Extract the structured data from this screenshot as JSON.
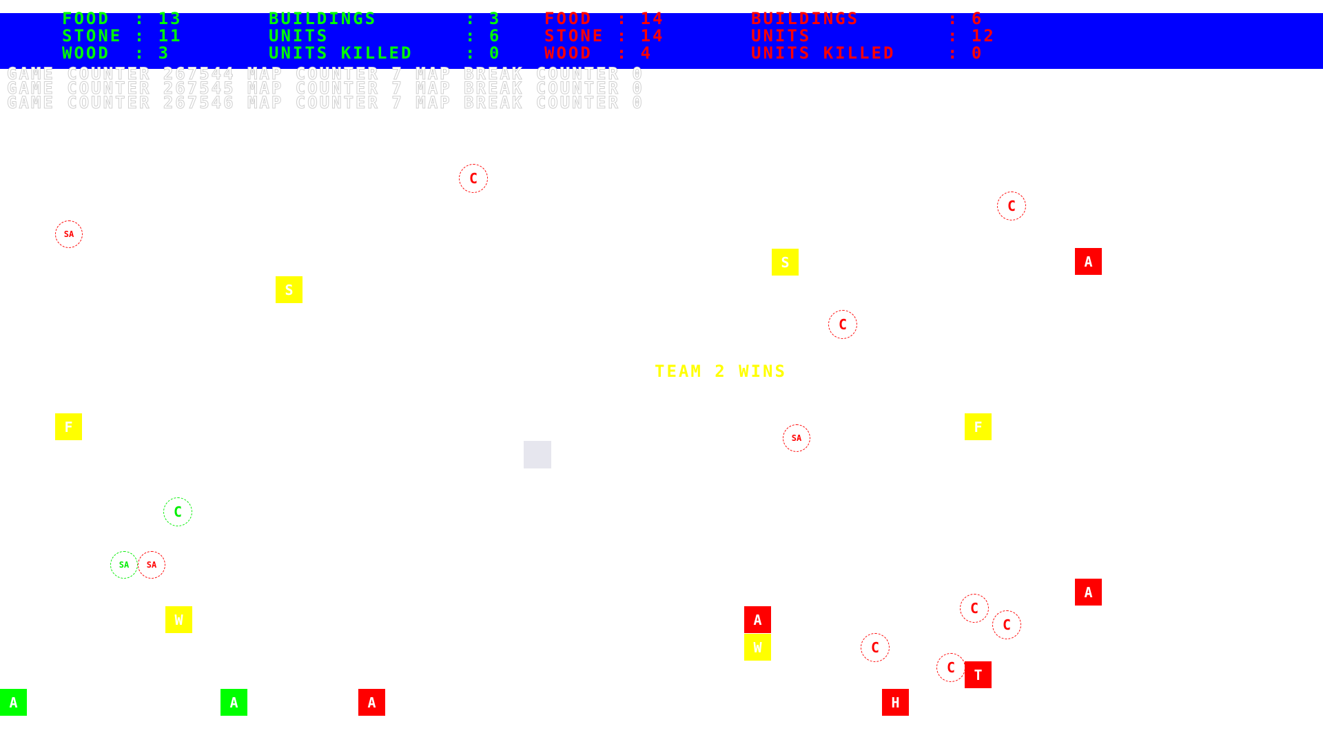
{
  "hud": {
    "team1": {
      "food_label": "FOOD",
      "food_value": "13",
      "stone_label": "STONE",
      "stone_value": "11",
      "wood_label": "WOOD",
      "wood_value": "3",
      "buildings_label": "BUILDINGS",
      "buildings_value": "3",
      "units_label": "UNITS",
      "units_value": "6",
      "killed_label": "UNITS KILLED",
      "killed_value": "0"
    },
    "team2": {
      "food_label": "FOOD",
      "food_value": "14",
      "stone_label": "STONE",
      "stone_value": "14",
      "wood_label": "WOOD",
      "wood_value": "4",
      "buildings_label": "BUILDINGS",
      "buildings_value": "6",
      "units_label": "UNITS",
      "units_value": "12",
      "killed_label": "UNITS KILLED",
      "killed_value": "0"
    },
    "separator": ":",
    "colors": {
      "bar": "#0000ff",
      "team1": "#00ff00",
      "team2": "#ff0000"
    }
  },
  "counters": [
    "GAME COUNTER 267544 MAP COUNTER 7 MAP BREAK COUNTER 0",
    "GAME COUNTER 267545 MAP COUNTER 7 MAP BREAK COUNTER 0",
    "GAME COUNTER 267546 MAP COUNTER 7 MAP BREAK COUNTER 0"
  ],
  "win_message": "TEAM 2 WINS",
  "map": {
    "resources": [
      {
        "label": "S",
        "kind": "stone"
      },
      {
        "label": "S",
        "kind": "stone"
      },
      {
        "label": "F",
        "kind": "food"
      },
      {
        "label": "F",
        "kind": "food"
      },
      {
        "label": "W",
        "kind": "wood"
      },
      {
        "label": "W",
        "kind": "wood"
      }
    ],
    "buildings": [
      {
        "label": "A",
        "team": "team2"
      },
      {
        "label": "A",
        "team": "team2"
      },
      {
        "label": "A",
        "team": "team2"
      },
      {
        "label": "T",
        "team": "team2"
      },
      {
        "label": "A",
        "team": "team1"
      },
      {
        "label": "A",
        "team": "team1"
      },
      {
        "label": "A",
        "team": "team2"
      },
      {
        "label": "H",
        "team": "team2"
      }
    ],
    "units": [
      {
        "label": "C",
        "team": "team2"
      },
      {
        "label": "C",
        "team": "team2"
      },
      {
        "label": "SA",
        "team": "team2"
      },
      {
        "label": "C",
        "team": "team2"
      },
      {
        "label": "SA",
        "team": "team2"
      },
      {
        "label": "C",
        "team": "team1"
      },
      {
        "label": "SA",
        "team": "team1"
      },
      {
        "label": "SA",
        "team": "team2"
      },
      {
        "label": "C",
        "team": "team2"
      },
      {
        "label": "C",
        "team": "team2"
      },
      {
        "label": "C",
        "team": "team2"
      },
      {
        "label": "C",
        "team": "team2"
      }
    ],
    "resource_color": "#ffff00",
    "neutral_tile_color": "#e6e6ee"
  }
}
